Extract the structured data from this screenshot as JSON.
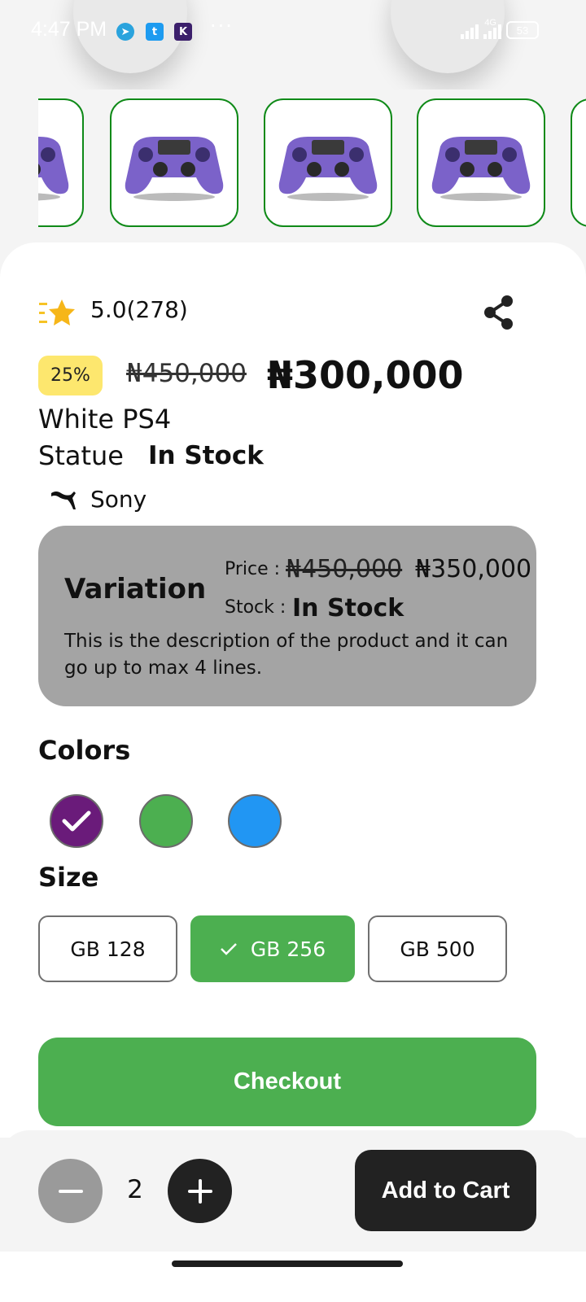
{
  "status_bar": {
    "time": "4:47 PM",
    "more": "···",
    "network": "4G",
    "battery": "53"
  },
  "product": {
    "rating": "5.0",
    "reviews": "(278)",
    "discount": "25%",
    "old_price": "₦450,000",
    "new_price": "₦300,000",
    "name": "White PS4",
    "status_label": "Statue",
    "status_value": "In Stock",
    "brand": "Sony"
  },
  "variation": {
    "title": "Variation",
    "price_label": "Price :",
    "old_price": "₦450,000",
    "new_price": "₦350,000",
    "stock_label": "Stock :",
    "stock_value": "In Stock",
    "description": "This is the description of the product and it can go up to max 4 lines."
  },
  "colors": {
    "title": "Colors",
    "options": [
      "#6a1b7a",
      "#4caf50",
      "#2196f3"
    ],
    "selected_index": 0
  },
  "size": {
    "title": "Size",
    "options": [
      "GB 128",
      "GB 256",
      "GB 500"
    ],
    "selected_index": 1
  },
  "actions": {
    "checkout": "Checkout",
    "quantity": "2",
    "add_to_cart": "Add to Cart"
  },
  "theme": {
    "accent_green": "#4caf50",
    "thumb_border": "#0f8a18",
    "discount_bg": "#fde76e",
    "dark": "#222222"
  },
  "icons": [
    "minus-icon",
    "plus-icon",
    "share-icon",
    "star-icon",
    "puma-logo-icon",
    "check-icon",
    "controller-image"
  ]
}
